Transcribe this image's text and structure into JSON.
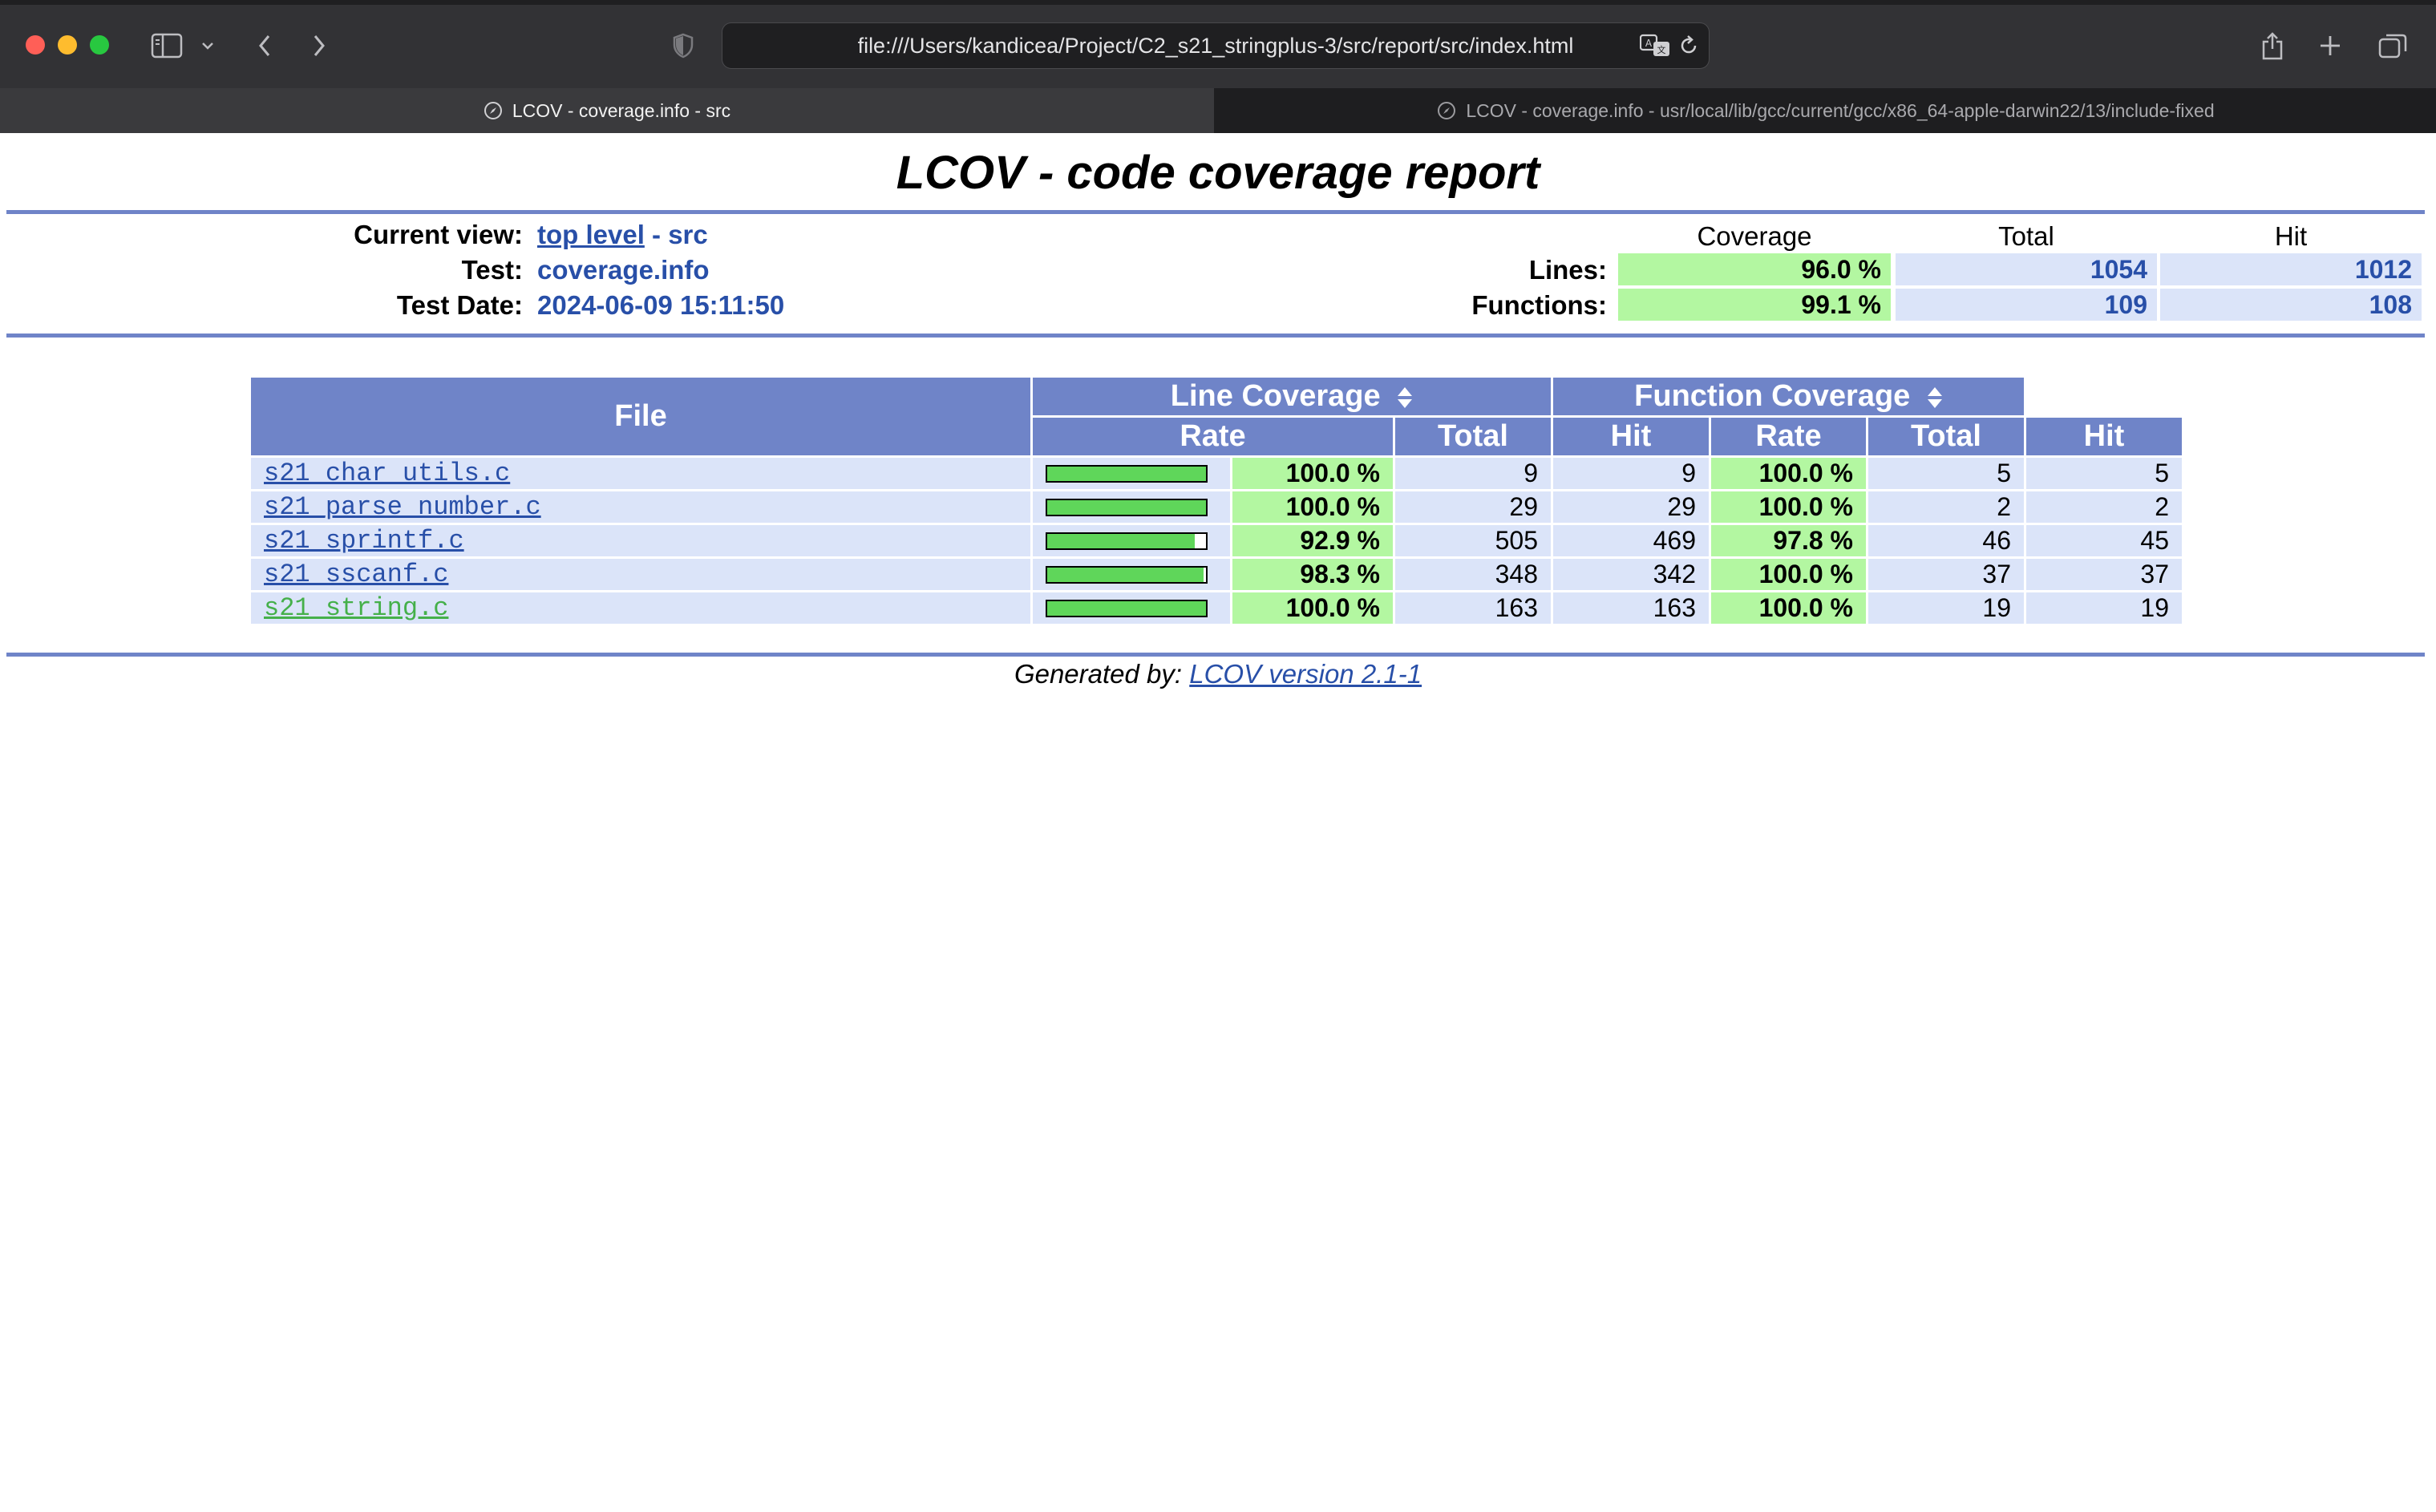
{
  "browser": {
    "url": "file:///Users/kandicea/Project/C2_s21_stringplus-3/src/report/src/index.html",
    "tabs": [
      {
        "label": "LCOV - coverage.info - src",
        "active": true
      },
      {
        "label": "LCOV - coverage.info - usr/local/lib/gcc/current/gcc/x86_64-apple-darwin22/13/include-fixed",
        "active": false
      }
    ],
    "colors": {
      "close": "#ff5f57",
      "minimize": "#febc2e",
      "zoom": "#28c840"
    }
  },
  "report": {
    "title": "LCOV - code coverage report",
    "current_view_label": "Current view:",
    "current_view_link": "top level",
    "current_view_rest": " - src",
    "test_label": "Test:",
    "test_value": "coverage.info",
    "date_label": "Test Date:",
    "date_value": "2024-06-09 15:11:50"
  },
  "summary": {
    "headers": {
      "coverage": "Coverage",
      "total": "Total",
      "hit": "Hit"
    },
    "lines": {
      "label": "Lines:",
      "coverage": "96.0 %",
      "total": "1054",
      "hit": "1012"
    },
    "functions": {
      "label": "Functions:",
      "coverage": "99.1 %",
      "total": "109",
      "hit": "108"
    }
  },
  "table": {
    "file_header": "File",
    "line_cov_header": "Line Coverage",
    "func_cov_header": "Function Coverage",
    "rate_header": "Rate",
    "total_header": "Total",
    "hit_header": "Hit",
    "rows": [
      {
        "file": "s21_char_utils.c",
        "line_fraction": 1.0,
        "line_rate": "100.0 %",
        "line_total": "9",
        "line_hit": "9",
        "func_rate": "100.0 %",
        "func_total": "5",
        "func_hit": "5"
      },
      {
        "file": "s21_parse_number.c",
        "line_fraction": 1.0,
        "line_rate": "100.0 %",
        "line_total": "29",
        "line_hit": "29",
        "func_rate": "100.0 %",
        "func_total": "2",
        "func_hit": "2"
      },
      {
        "file": "s21_sprintf.c",
        "line_fraction": 0.929,
        "line_rate": "92.9 %",
        "line_total": "505",
        "line_hit": "469",
        "func_rate": "97.8 %",
        "func_total": "46",
        "func_hit": "45"
      },
      {
        "file": "s21_sscanf.c",
        "line_fraction": 0.983,
        "line_rate": "98.3 %",
        "line_total": "348",
        "line_hit": "342",
        "func_rate": "100.0 %",
        "func_total": "37",
        "func_hit": "37"
      },
      {
        "file": "s21_string.c",
        "line_fraction": 1.0,
        "line_rate": "100.0 %",
        "line_total": "163",
        "line_hit": "163",
        "func_rate": "100.0 %",
        "func_total": "19",
        "func_hit": "19"
      }
    ]
  },
  "footer": {
    "prefix": "Generated by: ",
    "link": "LCOV version 2.1-1"
  }
}
